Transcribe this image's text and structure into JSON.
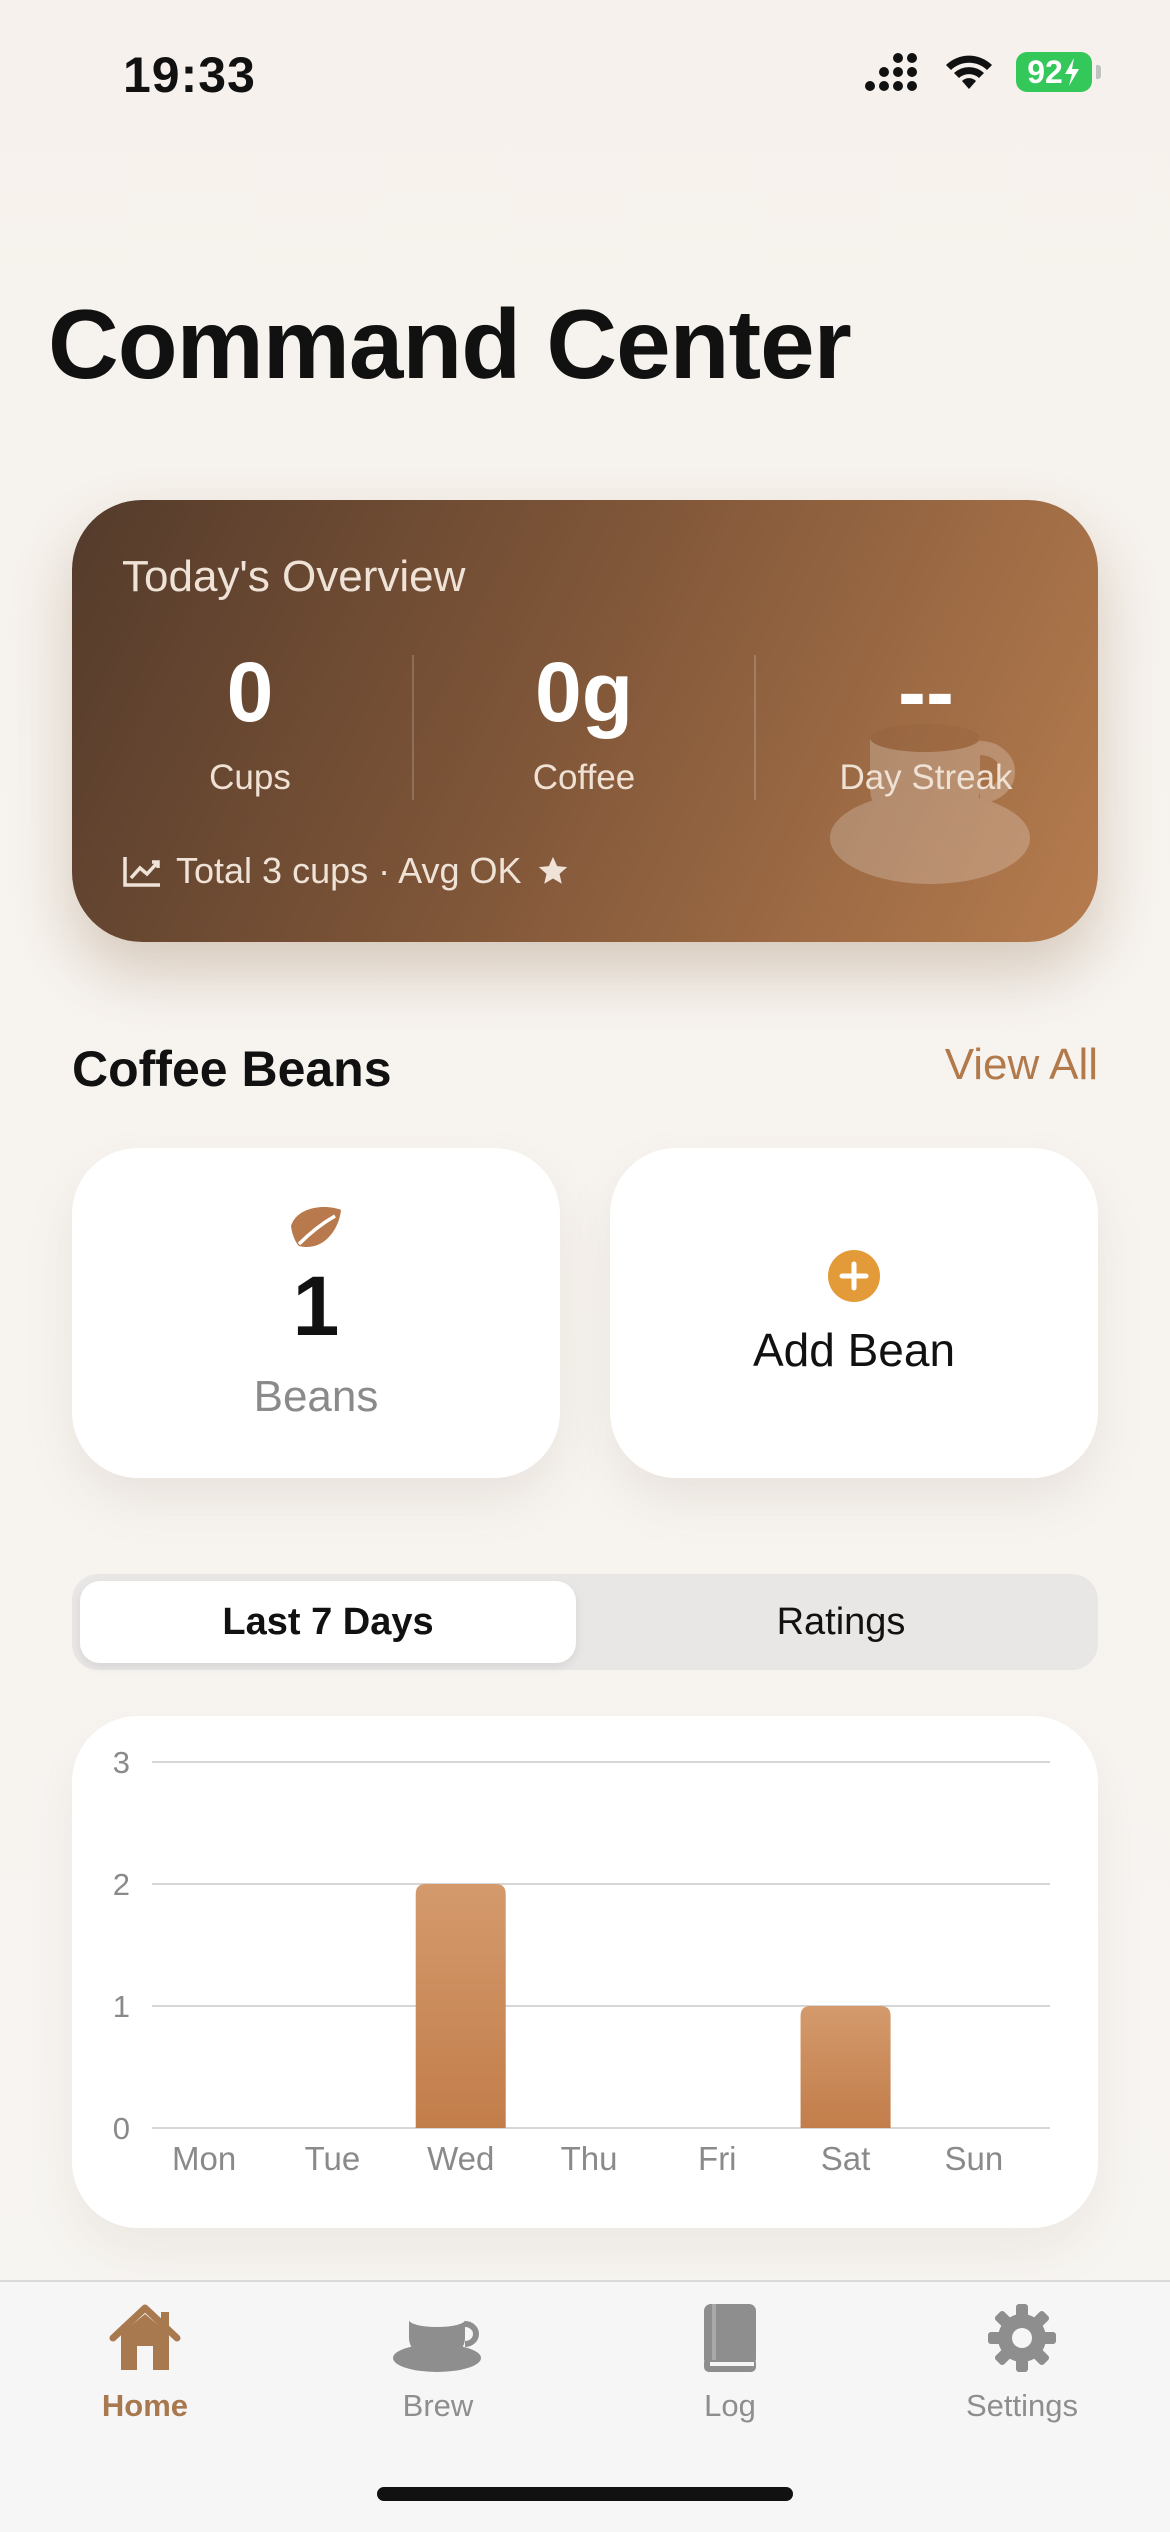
{
  "status": {
    "time": "19:33",
    "battery": "92"
  },
  "page": {
    "title": "Command Center"
  },
  "overview": {
    "title": "Today's Overview",
    "stats": [
      {
        "value": "0",
        "label": "Cups"
      },
      {
        "value": "0g",
        "label": "Coffee"
      },
      {
        "value": "--",
        "label": "Day Streak"
      }
    ],
    "footer": "Total 3 cups · Avg OK"
  },
  "beans": {
    "section_title": "Coffee Beans",
    "view_all": "View All",
    "count": "1",
    "count_label": "Beans",
    "add_label": "Add Bean"
  },
  "segment": {
    "active": "Last 7 Days",
    "other": "Ratings"
  },
  "chart_data": {
    "type": "bar",
    "categories": [
      "Mon",
      "Tue",
      "Wed",
      "Thu",
      "Fri",
      "Sat",
      "Sun"
    ],
    "values": [
      0,
      0,
      2,
      0,
      0,
      1,
      0
    ],
    "ylim": [
      0,
      3
    ],
    "yticks": [
      0,
      1,
      2,
      3
    ],
    "grid": true,
    "bar_color": "#c27d4a"
  },
  "tabs": [
    {
      "label": "Home",
      "icon": "house-icon",
      "active": true
    },
    {
      "label": "Brew",
      "icon": "coffee-cup-icon",
      "active": false
    },
    {
      "label": "Log",
      "icon": "book-icon",
      "active": false
    },
    {
      "label": "Settings",
      "icon": "gear-icon",
      "active": false
    }
  ],
  "colors": {
    "accent": "#b27a4b",
    "card_dark": "#543b2b",
    "card_light": "#b67c4e",
    "plus": "#e39a38"
  }
}
